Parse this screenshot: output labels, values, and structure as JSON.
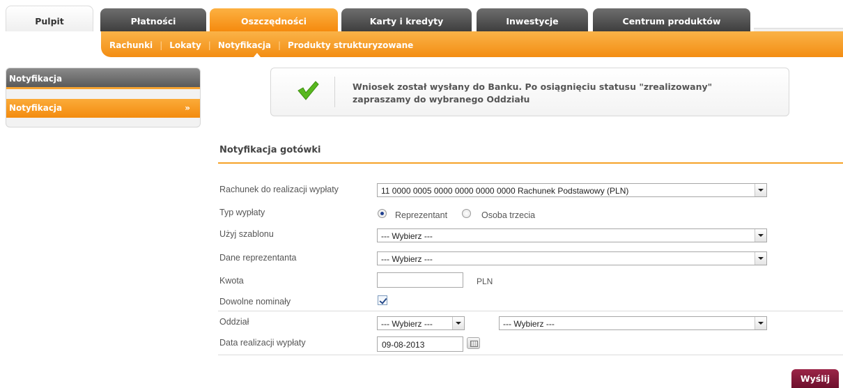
{
  "tabs": [
    {
      "label": "Pulpit"
    },
    {
      "label": "Płatności"
    },
    {
      "label": "Oszczędności"
    },
    {
      "label": "Karty i kredyty"
    },
    {
      "label": "Inwestycje"
    },
    {
      "label": "Centrum produktów"
    }
  ],
  "active_tab": "Oszczędności",
  "subnav": [
    {
      "label": "Rachunki"
    },
    {
      "label": "Lokaty"
    },
    {
      "label": "Notyfikacja"
    },
    {
      "label": "Produkty strukturyzowane"
    }
  ],
  "sidebar": {
    "heading": "Notyfikacja",
    "item": "Notyfikacja",
    "item_arrow": "»"
  },
  "message": {
    "icon": "check-icon",
    "line1": "Wniosek został wysłany do Banku. Po osiągnięciu statusu \"zrealizowany\"",
    "line2": "zapraszamy do wybranego Oddziału"
  },
  "form": {
    "title": "Notyfikacja gotówki",
    "account_label": "Rachunek do realizacji wypłaty",
    "account_value": "11 0000 0005 0000 0000 0000 0000 Rachunek Podstawowy (PLN)",
    "payout_type_label": "Typ wypłaty",
    "payout_type_options": [
      "Reprezentant",
      "Osoba trzecia"
    ],
    "payout_type_selected": "Reprezentant",
    "template_label": "Użyj szablonu",
    "template_value": "--- Wybierz ---",
    "rep_label": "Dane reprezentanta",
    "rep_value": "--- Wybierz ---",
    "amount_label": "Kwota",
    "amount_value": "",
    "amount_unit": "PLN",
    "denominations_label": "Dowolne nominały",
    "denominations_checked": true,
    "branch_label": "Oddział",
    "branch_value_1": "--- Wybierz ---",
    "branch_value_2": "--- Wybierz ---",
    "date_label": "Data realizacji wypłaty",
    "date_value": "09-08-2013",
    "submit_label": "Wyślij"
  }
}
